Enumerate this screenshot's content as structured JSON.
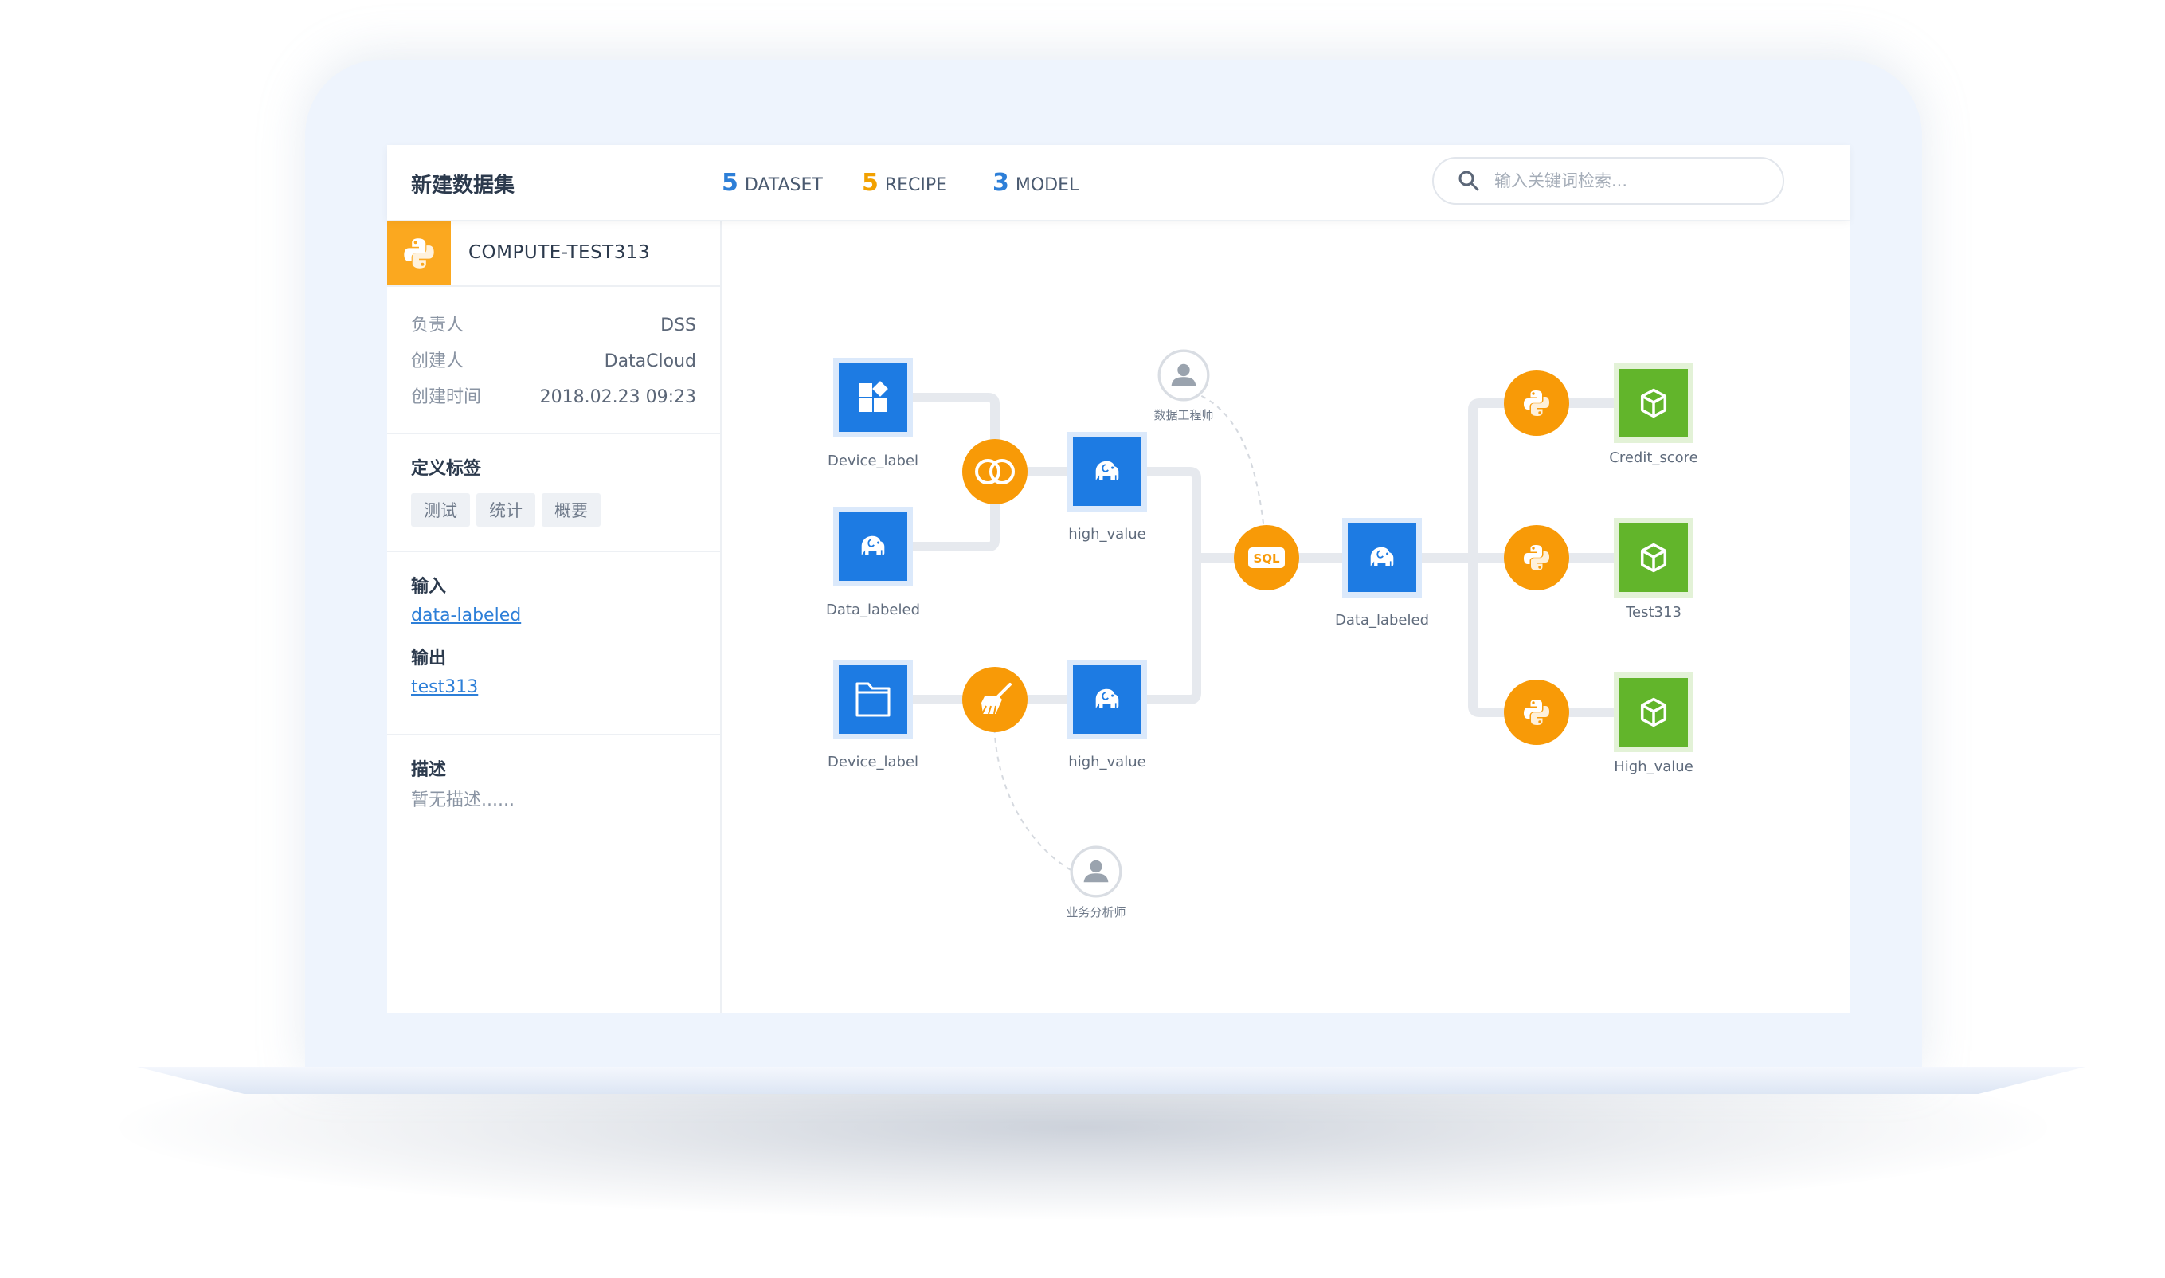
{
  "header": {
    "title": "新建数据集",
    "stats": [
      {
        "count": "5",
        "label": "DATASET",
        "color": "#2d7fd8"
      },
      {
        "count": "5",
        "label": "RECIPE",
        "color": "#f2a100"
      },
      {
        "count": "3",
        "label": "MODEL",
        "color": "#2d7fd8"
      }
    ],
    "search_placeholder": "输入关键词检索..."
  },
  "sidebar": {
    "recipe_name": "COMPUTE-TEST313",
    "meta": [
      {
        "label": "负责人",
        "value": "DSS"
      },
      {
        "label": "创建人",
        "value": "DataCloud"
      },
      {
        "label": "创建时间",
        "value": "2018.02.23 09:23"
      }
    ],
    "tags_title": "定义标签",
    "tags": [
      "测试",
      "统计",
      "概要"
    ],
    "input_title": "输入",
    "input_link": "data-labeled",
    "output_title": "输出",
    "output_link": "test313",
    "desc_title": "描述",
    "desc_text": "暂无描述......"
  },
  "flow": {
    "labels": {
      "device_label_1": "Device_label",
      "data_labeled_1": "Data_labeled",
      "high_value_1": "high_value",
      "device_label_2": "Device_label",
      "high_value_2": "high_value",
      "data_labeled_2": "Data_labeled",
      "credit_score": "Credit_score",
      "test313": "Test313",
      "high_value_model": "High_value",
      "data_engineer": "数据工程师",
      "business_analyst": "业务分析师",
      "sql_text": "SQL"
    },
    "colors": {
      "dataset": "#1d7be3",
      "recipe": "#f89a07",
      "model": "#62b52b",
      "edge": "#e6e9ee"
    }
  }
}
